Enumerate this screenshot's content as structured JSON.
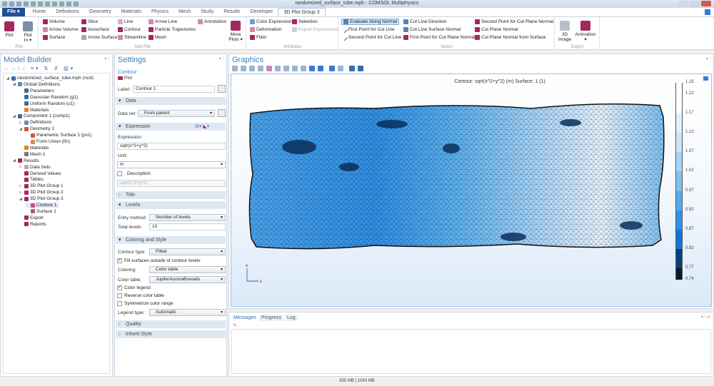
{
  "window": {
    "title": "randomized_surface_tube.mph - COMSOL Multiphysics"
  },
  "tabs": [
    "File ▾",
    "Home",
    "Definitions",
    "Geometry",
    "Materials",
    "Physics",
    "Mesh",
    "Study",
    "Results",
    "Developer",
    "3D Plot Group 3"
  ],
  "ribbon": {
    "plot": {
      "plot": "Plot",
      "plot_in": "Plot In ▾",
      "group": "Plot"
    },
    "add_plot": {
      "items": [
        "Volume",
        "Arrow Volume",
        "Surface",
        "Slice",
        "Isosurface",
        "Arrow Surface",
        "Line",
        "Contour",
        "Streamline",
        "Arrow Line",
        "Particle Trajectories",
        "Mesh",
        "Annotation"
      ],
      "more": "More Plots ▾",
      "group": "Add Plot"
    },
    "attributes": {
      "items": [
        "Color Expression",
        "Deformation",
        "Filter",
        "Selection",
        "Export Expressions"
      ],
      "group": "Attributes"
    },
    "select": {
      "items": [
        "Evaluate Along Normal",
        "First Point for Cut Line",
        "Second Point for Cut Line",
        "Cut Line Direction",
        "Cut Line Surface Normal",
        "First Point for Cut Plane Normal",
        "Second Point for Cut Plane Normal",
        "Cut Plane Normal",
        "Cut Plane Normal from Surface"
      ],
      "group": "Select"
    },
    "export": {
      "image": "3D Image",
      "animation": "Animation ▾",
      "group": "Export"
    }
  },
  "model_builder": {
    "title": "Model Builder",
    "tree": [
      {
        "label": "randomized_surface_tube.mph (root)",
        "color": "#3a6ea5"
      },
      {
        "label": "Global Definitions",
        "color": "#5b8ac4"
      },
      {
        "label": "Parameters",
        "color": "#3a6ea5"
      },
      {
        "label": "Gaussian Random (g1)",
        "color": "#3a6ea5"
      },
      {
        "label": "Uniform Random (u1)",
        "color": "#3a6ea5"
      },
      {
        "label": "Materials",
        "color": "#e08a20"
      },
      {
        "label": "Component 1 (comp1)",
        "color": "#3a6ea5"
      },
      {
        "label": "Definitions",
        "color": "#6a8ab8"
      },
      {
        "label": "Geometry 1",
        "color": "#d05a30"
      },
      {
        "label": "Parametric Surface 1 (ps1)",
        "color": "#d05a30"
      },
      {
        "label": "Form Union (fin)",
        "color": "#d08a60"
      },
      {
        "label": "Materials",
        "color": "#e08a20"
      },
      {
        "label": "Mesh 1",
        "color": "#777"
      },
      {
        "label": "Results",
        "color": "#a2285f"
      },
      {
        "label": "Data Sets",
        "color": "#c9a0b4"
      },
      {
        "label": "Derived Values",
        "color": "#a2285f"
      },
      {
        "label": "Tables",
        "color": "#a2285f"
      },
      {
        "label": "3D Plot Group 1",
        "color": "#a2285f"
      },
      {
        "label": "3D Plot Group 2",
        "color": "#a2285f"
      },
      {
        "label": "3D Plot Group 3",
        "color": "#a2285f"
      },
      {
        "label": "Contour 1",
        "color": "#c05080"
      },
      {
        "label": "Surface 1",
        "color": "#c05080"
      },
      {
        "label": "Export",
        "color": "#a2285f"
      },
      {
        "label": "Reports",
        "color": "#a2285f"
      }
    ]
  },
  "settings": {
    "title": "Settings",
    "subtitle": "Contour",
    "plot_link": "Plot",
    "label_label": "Label:",
    "label_value": "Contour 1",
    "sections": {
      "data": "Data",
      "expression": "Expression",
      "title": "Title",
      "levels": "Levels",
      "coloring": "Coloring and Style",
      "quality": "Quality",
      "inherit": "Inherit Style"
    },
    "data_set_label": "Data set:",
    "data_set": "From parent",
    "expression_label": "Expression:",
    "expression": "sqrt(x^2+y^2)",
    "unit_label": "Unit:",
    "unit": "m",
    "description_label": "Description:",
    "description": "sqrt(x^2+y^2)",
    "entry_method_label": "Entry method:",
    "entry_method": "Number of levels",
    "total_levels_label": "Total levels:",
    "total_levels": "10",
    "contour_type_label": "Contour type:",
    "contour_type": "Filled",
    "fill_outside": "Fill surfaces outside of contour levels",
    "coloring_label": "Coloring:",
    "coloring": "Color table",
    "color_table_label": "Color table:",
    "color_table": "JupiterAuroraBorealis",
    "color_legend": "Color legend",
    "reverse": "Reverse color table",
    "symmetrize": "Symmetrize color range",
    "legend_type_label": "Legend type:",
    "legend_type": "Automatic"
  },
  "graphics": {
    "title": "Graphics",
    "plot_title": "Contour: sqrt(x^2+y^2) (m)  Surface: 1 (1)",
    "legend": {
      "ticks": [
        "1.25",
        "1.22",
        "1.17",
        "1.12",
        "1.07",
        "1.02",
        "0.97",
        "0.92",
        "0.87",
        "0.82",
        "0.77",
        "0.74"
      ],
      "colors": [
        "#ffffff",
        "#e3f0fc",
        "#cbe4fa",
        "#a9d4f7",
        "#80c0f2",
        "#57aaee",
        "#2f93e8",
        "#1276d4",
        "#0a3f78",
        "#081a2e"
      ]
    },
    "axes": {
      "x": "x",
      "z": "z"
    }
  },
  "messages": {
    "tabs": [
      "Messages",
      "Progress",
      "Log"
    ]
  },
  "status": {
    "memory": "935 MB | 1043 MB"
  }
}
